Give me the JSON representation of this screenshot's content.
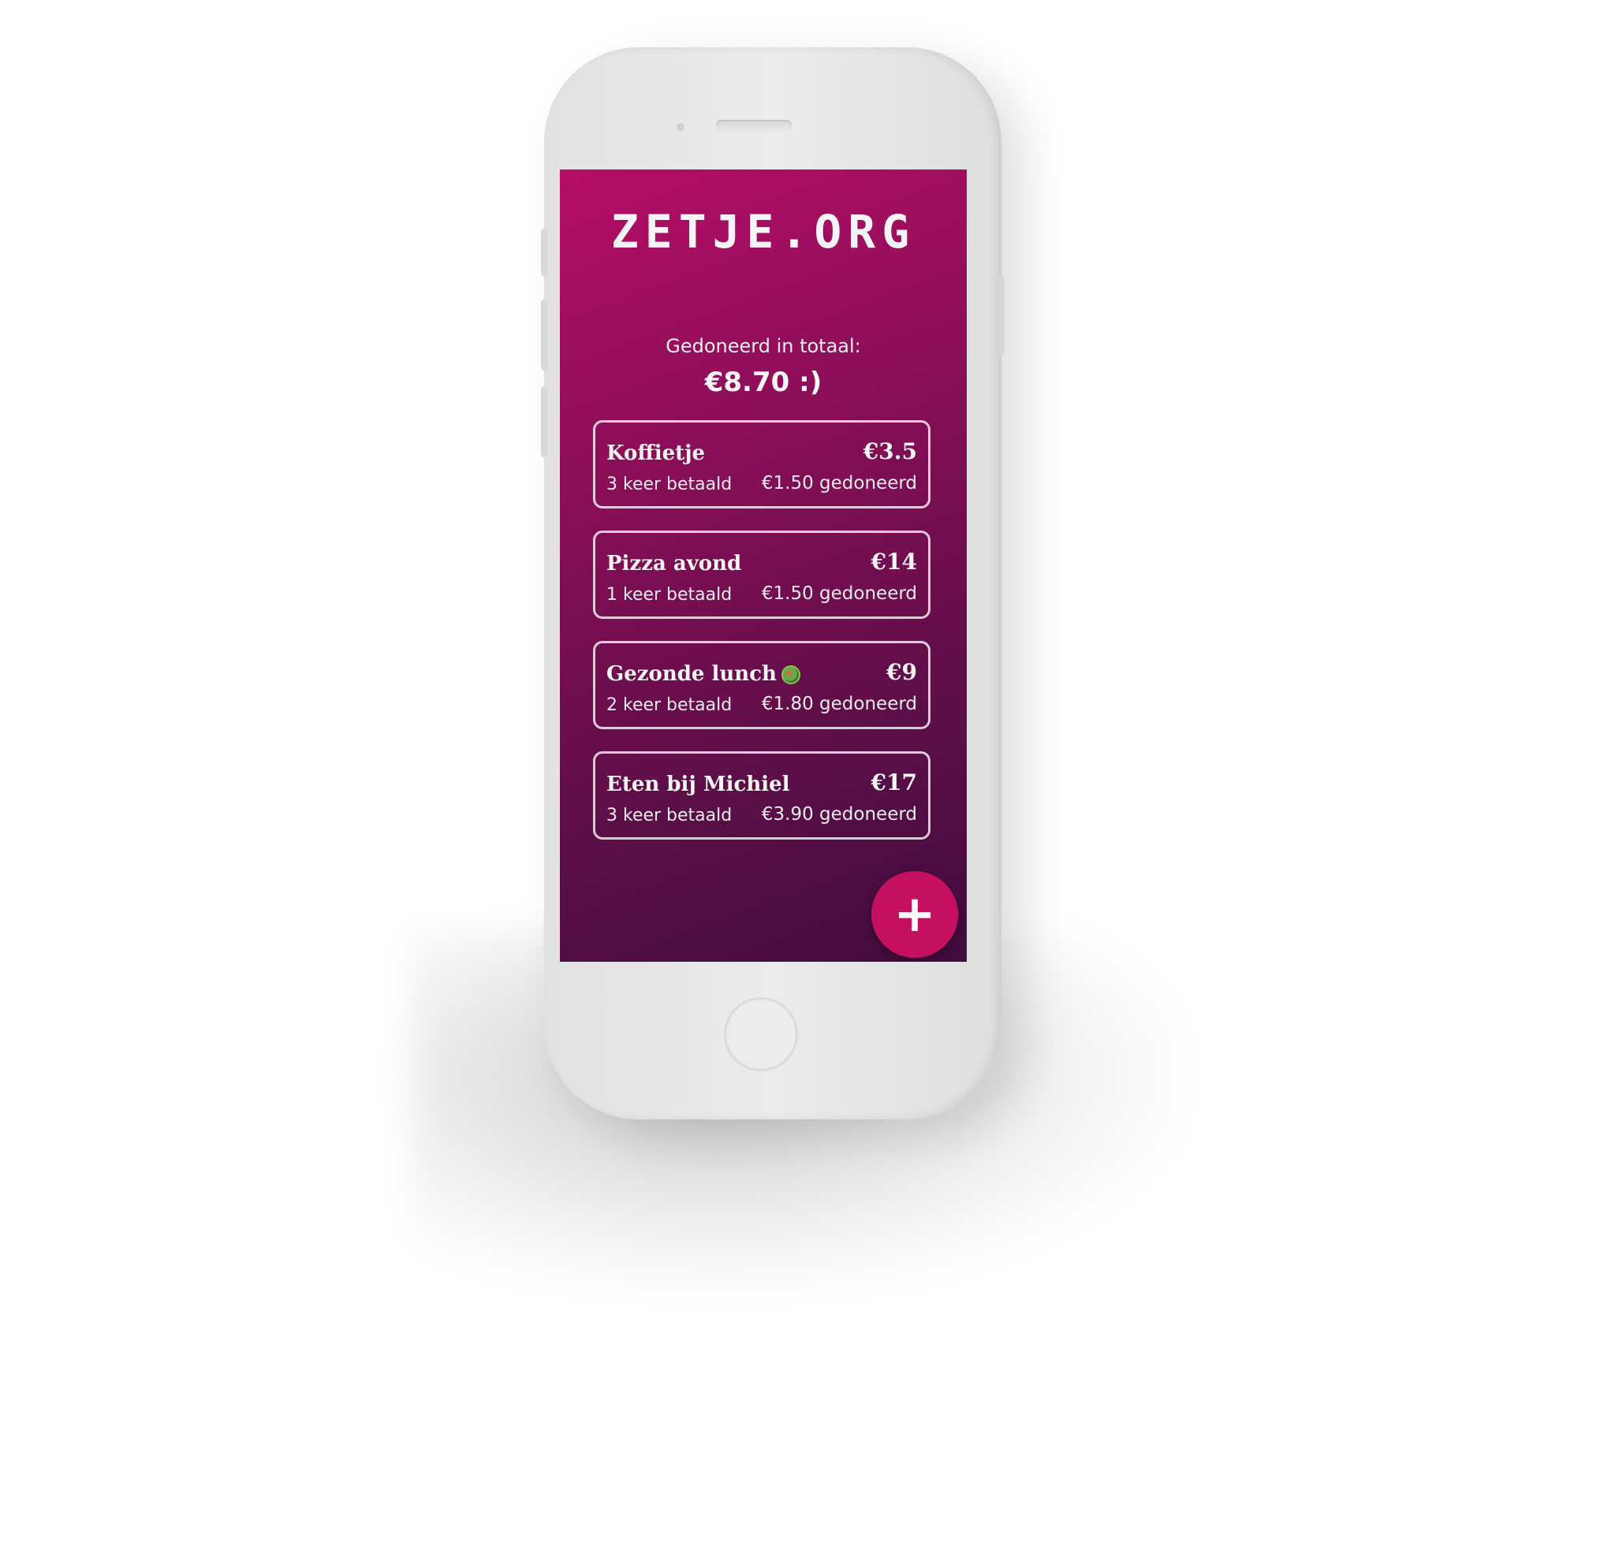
{
  "app": {
    "logo": "ZETJE.ORG"
  },
  "summary": {
    "label": "Gedoneerd in totaal:",
    "value": "€8.70 :)"
  },
  "items": [
    {
      "name": "Koffietje",
      "price": "€3.5",
      "count": "3 keer betaald",
      "donated": "€1.50 gedoneerd",
      "icon": ""
    },
    {
      "name": "Pizza avond",
      "price": "€14",
      "count": "1 keer betaald",
      "donated": "€1.50 gedoneerd",
      "icon": ""
    },
    {
      "name": "Gezonde lunch",
      "price": "€9",
      "count": "2 keer betaald",
      "donated": "€1.80 gedoneerd",
      "icon": "salad-icon"
    },
    {
      "name": "Eten bij Michiel",
      "price": "€17",
      "count": "3 keer betaald",
      "donated": "€3.90 gedoneerd",
      "icon": ""
    }
  ],
  "fab": {
    "label": "+",
    "icon": "plus-icon",
    "color": "#c4105f"
  },
  "colors": {
    "gradient_top": "#b50d66",
    "gradient_bottom": "#420c3e"
  }
}
